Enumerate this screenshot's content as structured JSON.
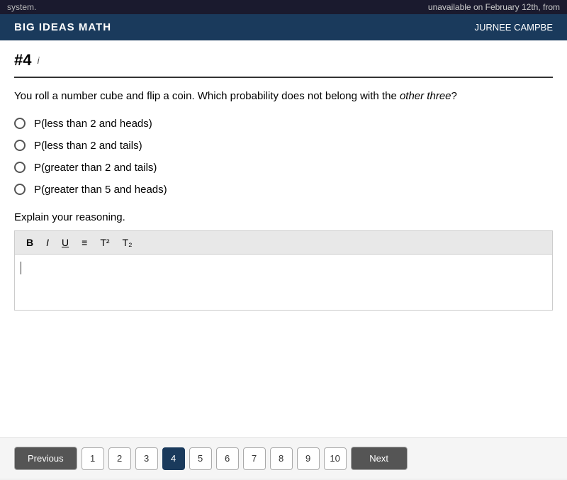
{
  "topbar": {
    "text": "system.",
    "right_text": "unavailable on February 12th, from"
  },
  "header": {
    "logo": "BIG IDEAS MATH",
    "user": "JURNEE CAMPBE"
  },
  "question": {
    "number": "#4",
    "info_icon": "i",
    "text_part1": "You roll a number cube and flip a coin. Which probability does not belong with the ",
    "text_italic": "other three",
    "text_part2": "?",
    "options": [
      "P(less than 2 and heads)",
      "P(less than 2 and tails)",
      "P(greater than 2 and tails)",
      "P(greater than 5 and heads)"
    ],
    "explain_label": "Explain your reasoning."
  },
  "toolbar": {
    "bold": "B",
    "italic": "I",
    "underline": "U",
    "list": "≡",
    "superscript": "T²",
    "subscript": "T₂"
  },
  "navigation": {
    "previous_label": "Previous",
    "next_label": "Next",
    "pages": [
      "1",
      "2",
      "3",
      "4",
      "5",
      "6",
      "7",
      "8",
      "9",
      "10"
    ],
    "active_page": "4"
  }
}
